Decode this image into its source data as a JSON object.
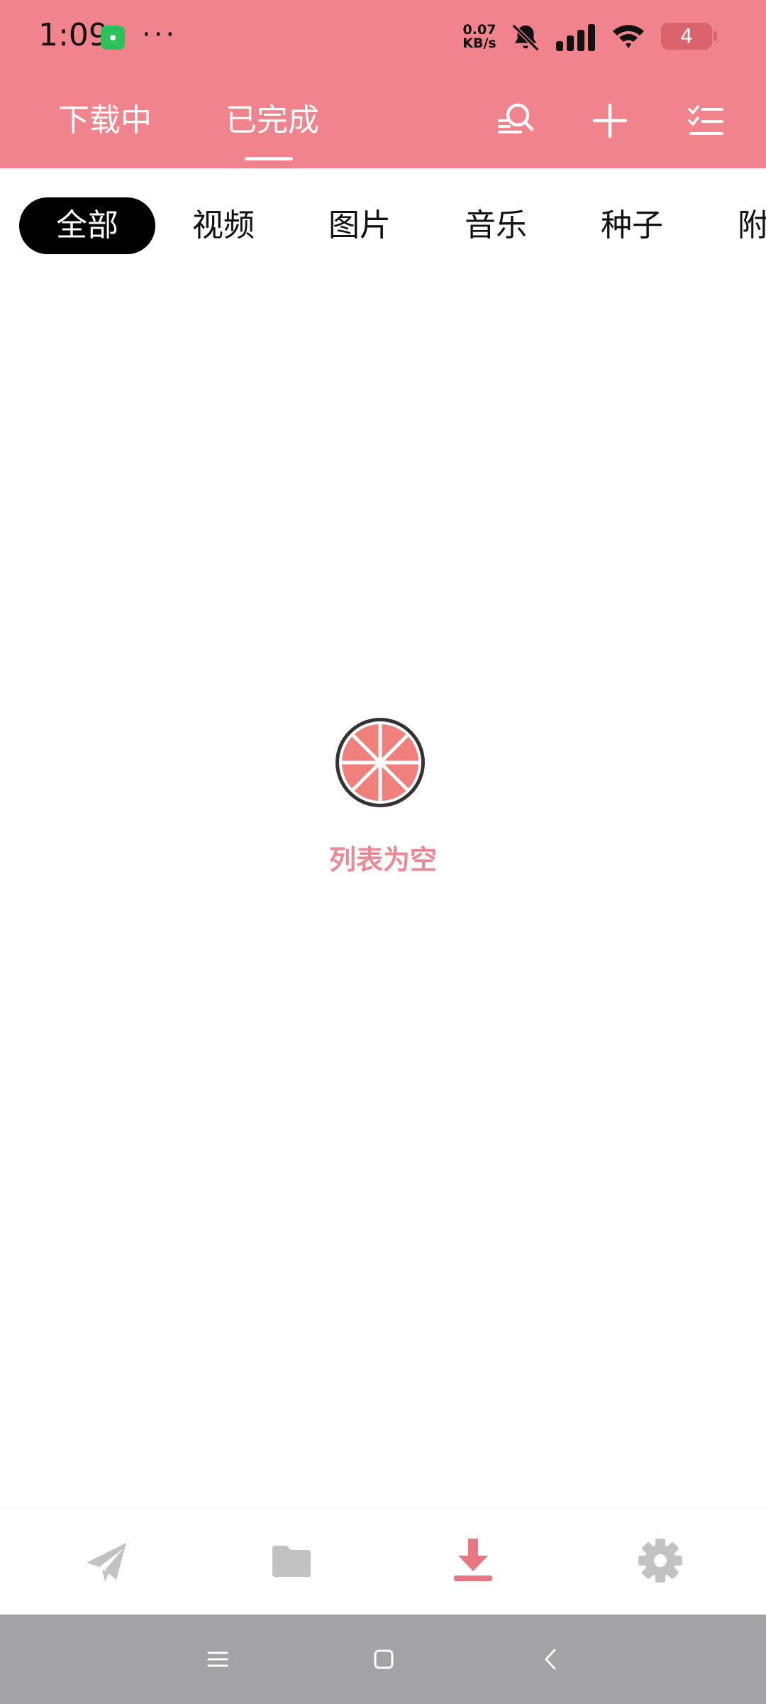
{
  "status_bar": {
    "time": "1:09",
    "dots": "···",
    "net_speed_value": "0.07",
    "net_speed_unit": "KB/s",
    "battery_level": "4",
    "icons": [
      "shield-app-icon",
      "bell-muted-icon",
      "signal-icon",
      "wifi-icon",
      "battery-icon"
    ]
  },
  "header": {
    "tabs": [
      {
        "label": "下载中",
        "active": false
      },
      {
        "label": "已完成",
        "active": true
      }
    ],
    "actions": [
      "search-list-icon",
      "plus-icon",
      "checklist-icon"
    ]
  },
  "filters": {
    "chips": [
      {
        "label": "全部",
        "active": true
      },
      {
        "label": "视频",
        "active": false
      },
      {
        "label": "图片",
        "active": false
      },
      {
        "label": "音乐",
        "active": false
      },
      {
        "label": "种子",
        "active": false
      },
      {
        "label": "附",
        "active": false
      }
    ]
  },
  "empty_state": {
    "message": "列表为空",
    "icon": "grapefruit-icon"
  },
  "bottom_nav": {
    "items": [
      {
        "icon": "paper-plane-icon",
        "active": false
      },
      {
        "icon": "folder-icon",
        "active": false
      },
      {
        "icon": "download-icon",
        "active": true
      },
      {
        "icon": "gear-icon",
        "active": false
      }
    ]
  },
  "system_nav": {
    "buttons": [
      "menu-icon",
      "home-icon",
      "back-icon"
    ]
  },
  "colors": {
    "header_bg": "#F1838C",
    "accent": "#E97783",
    "inactive_icon": "#C2C2C2",
    "empty_text": "#E98A96",
    "system_bar": "#A2A2A7"
  }
}
